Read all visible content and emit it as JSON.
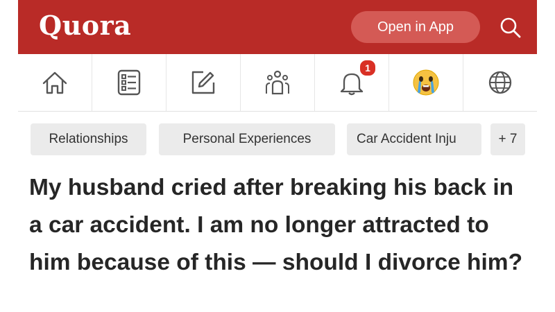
{
  "header": {
    "logo": "Quora",
    "open_app_label": "Open in App",
    "search_icon": "search-icon",
    "brand_color": "#b92b27"
  },
  "nav": {
    "items": [
      {
        "name": "home",
        "icon": "home-icon"
      },
      {
        "name": "following",
        "icon": "following-icon"
      },
      {
        "name": "answer",
        "icon": "edit-icon"
      },
      {
        "name": "spaces",
        "icon": "spaces-icon"
      },
      {
        "name": "notifications",
        "icon": "bell-icon",
        "badge": "1"
      },
      {
        "name": "profile",
        "icon": "crying-face-avatar"
      },
      {
        "name": "languages",
        "icon": "globe-icon"
      }
    ]
  },
  "tags": [
    {
      "label": "Relationships"
    },
    {
      "label": "Personal Experiences"
    },
    {
      "label": "Car Accident Inju"
    },
    {
      "label": "+ 7"
    }
  ],
  "question": {
    "title": "My husband cried after breaking his back in a car accident. I am no longer attracted to him because of this — should I divorce him?"
  }
}
